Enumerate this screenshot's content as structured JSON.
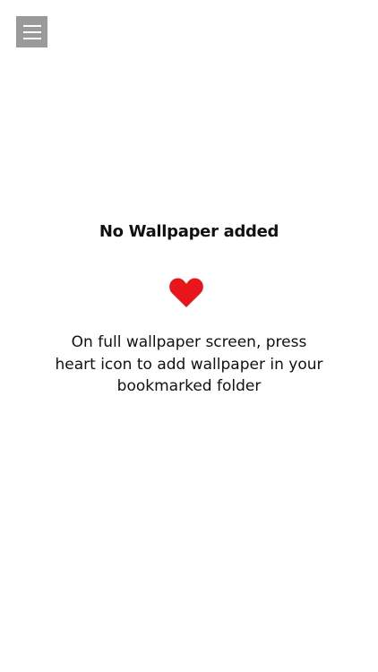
{
  "header": {
    "menu_icon": "hamburger-menu-icon"
  },
  "empty_state": {
    "title": "No Wallpaper added",
    "heart_icon": "heart-icon",
    "heart_color": "#e8151b",
    "message": "On full wallpaper screen, press heart icon to add wallpaper in your bookmarked folder"
  }
}
